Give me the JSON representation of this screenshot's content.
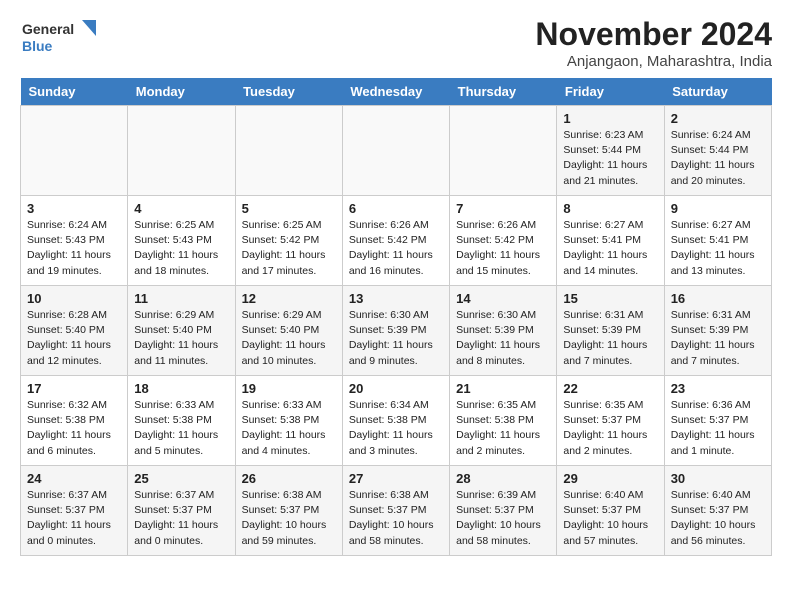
{
  "header": {
    "logo_general": "General",
    "logo_blue": "Blue",
    "month_title": "November 2024",
    "location": "Anjangaon, Maharashtra, India"
  },
  "columns": [
    "Sunday",
    "Monday",
    "Tuesday",
    "Wednesday",
    "Thursday",
    "Friday",
    "Saturday"
  ],
  "weeks": [
    [
      {
        "day": "",
        "info": ""
      },
      {
        "day": "",
        "info": ""
      },
      {
        "day": "",
        "info": ""
      },
      {
        "day": "",
        "info": ""
      },
      {
        "day": "",
        "info": ""
      },
      {
        "day": "1",
        "info": "Sunrise: 6:23 AM\nSunset: 5:44 PM\nDaylight: 11 hours\nand 21 minutes."
      },
      {
        "day": "2",
        "info": "Sunrise: 6:24 AM\nSunset: 5:44 PM\nDaylight: 11 hours\nand 20 minutes."
      }
    ],
    [
      {
        "day": "3",
        "info": "Sunrise: 6:24 AM\nSunset: 5:43 PM\nDaylight: 11 hours\nand 19 minutes."
      },
      {
        "day": "4",
        "info": "Sunrise: 6:25 AM\nSunset: 5:43 PM\nDaylight: 11 hours\nand 18 minutes."
      },
      {
        "day": "5",
        "info": "Sunrise: 6:25 AM\nSunset: 5:42 PM\nDaylight: 11 hours\nand 17 minutes."
      },
      {
        "day": "6",
        "info": "Sunrise: 6:26 AM\nSunset: 5:42 PM\nDaylight: 11 hours\nand 16 minutes."
      },
      {
        "day": "7",
        "info": "Sunrise: 6:26 AM\nSunset: 5:42 PM\nDaylight: 11 hours\nand 15 minutes."
      },
      {
        "day": "8",
        "info": "Sunrise: 6:27 AM\nSunset: 5:41 PM\nDaylight: 11 hours\nand 14 minutes."
      },
      {
        "day": "9",
        "info": "Sunrise: 6:27 AM\nSunset: 5:41 PM\nDaylight: 11 hours\nand 13 minutes."
      }
    ],
    [
      {
        "day": "10",
        "info": "Sunrise: 6:28 AM\nSunset: 5:40 PM\nDaylight: 11 hours\nand 12 minutes."
      },
      {
        "day": "11",
        "info": "Sunrise: 6:29 AM\nSunset: 5:40 PM\nDaylight: 11 hours\nand 11 minutes."
      },
      {
        "day": "12",
        "info": "Sunrise: 6:29 AM\nSunset: 5:40 PM\nDaylight: 11 hours\nand 10 minutes."
      },
      {
        "day": "13",
        "info": "Sunrise: 6:30 AM\nSunset: 5:39 PM\nDaylight: 11 hours\nand 9 minutes."
      },
      {
        "day": "14",
        "info": "Sunrise: 6:30 AM\nSunset: 5:39 PM\nDaylight: 11 hours\nand 8 minutes."
      },
      {
        "day": "15",
        "info": "Sunrise: 6:31 AM\nSunset: 5:39 PM\nDaylight: 11 hours\nand 7 minutes."
      },
      {
        "day": "16",
        "info": "Sunrise: 6:31 AM\nSunset: 5:39 PM\nDaylight: 11 hours\nand 7 minutes."
      }
    ],
    [
      {
        "day": "17",
        "info": "Sunrise: 6:32 AM\nSunset: 5:38 PM\nDaylight: 11 hours\nand 6 minutes."
      },
      {
        "day": "18",
        "info": "Sunrise: 6:33 AM\nSunset: 5:38 PM\nDaylight: 11 hours\nand 5 minutes."
      },
      {
        "day": "19",
        "info": "Sunrise: 6:33 AM\nSunset: 5:38 PM\nDaylight: 11 hours\nand 4 minutes."
      },
      {
        "day": "20",
        "info": "Sunrise: 6:34 AM\nSunset: 5:38 PM\nDaylight: 11 hours\nand 3 minutes."
      },
      {
        "day": "21",
        "info": "Sunrise: 6:35 AM\nSunset: 5:38 PM\nDaylight: 11 hours\nand 2 minutes."
      },
      {
        "day": "22",
        "info": "Sunrise: 6:35 AM\nSunset: 5:37 PM\nDaylight: 11 hours\nand 2 minutes."
      },
      {
        "day": "23",
        "info": "Sunrise: 6:36 AM\nSunset: 5:37 PM\nDaylight: 11 hours\nand 1 minute."
      }
    ],
    [
      {
        "day": "24",
        "info": "Sunrise: 6:37 AM\nSunset: 5:37 PM\nDaylight: 11 hours\nand 0 minutes."
      },
      {
        "day": "25",
        "info": "Sunrise: 6:37 AM\nSunset: 5:37 PM\nDaylight: 11 hours\nand 0 minutes."
      },
      {
        "day": "26",
        "info": "Sunrise: 6:38 AM\nSunset: 5:37 PM\nDaylight: 10 hours\nand 59 minutes."
      },
      {
        "day": "27",
        "info": "Sunrise: 6:38 AM\nSunset: 5:37 PM\nDaylight: 10 hours\nand 58 minutes."
      },
      {
        "day": "28",
        "info": "Sunrise: 6:39 AM\nSunset: 5:37 PM\nDaylight: 10 hours\nand 58 minutes."
      },
      {
        "day": "29",
        "info": "Sunrise: 6:40 AM\nSunset: 5:37 PM\nDaylight: 10 hours\nand 57 minutes."
      },
      {
        "day": "30",
        "info": "Sunrise: 6:40 AM\nSunset: 5:37 PM\nDaylight: 10 hours\nand 56 minutes."
      }
    ]
  ]
}
